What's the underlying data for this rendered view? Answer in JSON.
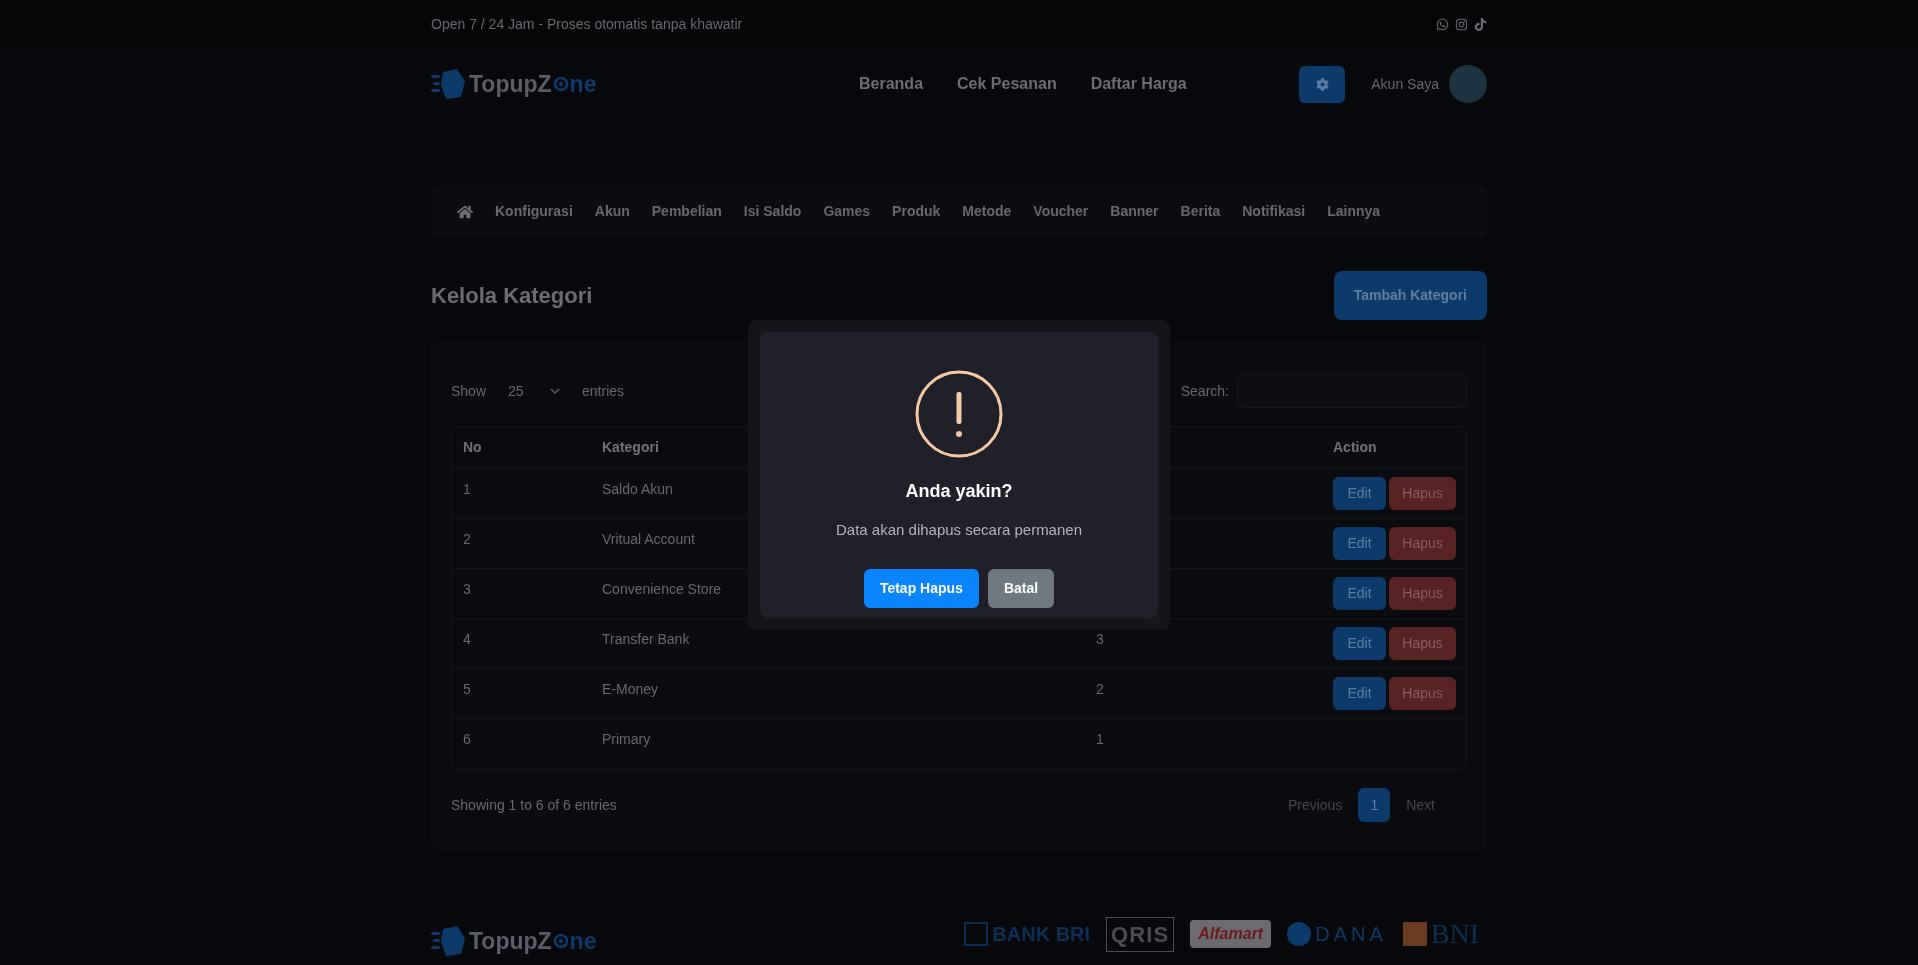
{
  "top_bar": {
    "tagline": "Open 7 / 24 Jam - Proses otomatis tanpa khawatir"
  },
  "header": {
    "logo": {
      "before_icon": "TopupZ",
      "after_icon": "ne"
    },
    "nav": [
      "Beranda",
      "Cek Pesanan",
      "Daftar Harga"
    ],
    "account_label": "Akun Saya"
  },
  "admin_menu": [
    "Konfigurasi",
    "Akun",
    "Pembelian",
    "Isi Saldo",
    "Games",
    "Produk",
    "Metode",
    "Voucher",
    "Banner",
    "Berita",
    "Notifikasi",
    "Lainnya"
  ],
  "page_title": "Kelola Kategori",
  "add_button": "Tambah Kategori",
  "table": {
    "show_label": "Show",
    "page_size": "25",
    "entries_label": "entries",
    "search_label": "Search:",
    "columns": {
      "no": "No",
      "kategori": "Kategori",
      "action": "Action"
    },
    "rows": [
      {
        "no": "1",
        "kategori": "Saldo Akun",
        "actions": [
          "Edit",
          "Hapus"
        ]
      },
      {
        "no": "2",
        "kategori": "Vritual Account",
        "actions": [
          "Edit",
          "Hapus"
        ]
      },
      {
        "no": "3",
        "kategori": "Convenience Store",
        "actions": [
          "Edit",
          "Hapus"
        ]
      },
      {
        "no": "4",
        "kategori": "Transfer Bank",
        "column_3": "3",
        "actions": [
          "Edit",
          "Hapus"
        ]
      },
      {
        "no": "5",
        "kategori": "E-Money",
        "column_3": "2",
        "actions": [
          "Edit",
          "Hapus"
        ]
      },
      {
        "no": "6",
        "kategori": "Primary",
        "column_3": "1"
      }
    ],
    "info": "Showing 1 to 6 of 6 entries",
    "pagination": [
      {
        "label": "Previous",
        "selected": false,
        "disabled": true
      },
      {
        "label": "1",
        "selected": true,
        "disabled": false
      },
      {
        "label": "Next",
        "selected": false,
        "disabled": true
      }
    ]
  },
  "modal": {
    "title": "Anda yakin?",
    "message": "Data akan dihapus secara permanen",
    "buttons": [
      {
        "label": "Tetap Hapus",
        "kind": "confirm"
      },
      {
        "label": "Batal",
        "kind": "cancel"
      }
    ]
  },
  "footer": {
    "logo": {
      "before_icon": "TopupZ",
      "after_icon": "ne"
    },
    "payment_logos": [
      {
        "kind": "bri",
        "label": "BANK BRI"
      },
      {
        "kind": "qris",
        "label": "QRIS"
      },
      {
        "kind": "alfamart",
        "label": "Alfamart"
      },
      {
        "kind": "dana",
        "label": "DANA"
      },
      {
        "kind": "bni",
        "label": "BNI"
      }
    ]
  }
}
